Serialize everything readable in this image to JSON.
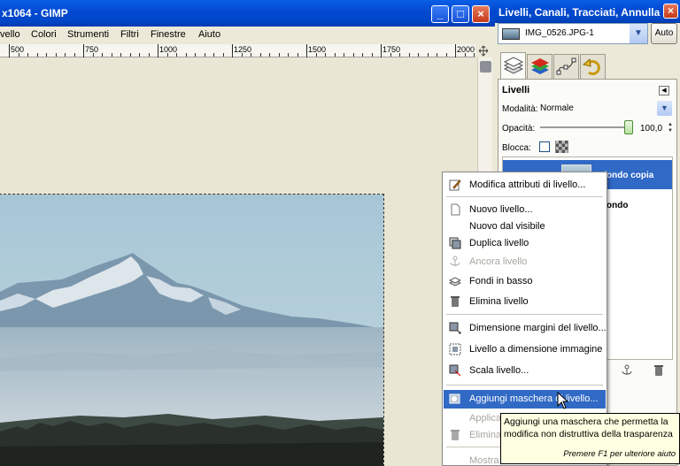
{
  "image_window": {
    "title": "x1064 - GIMP",
    "menu": [
      "vello",
      "Colori",
      "Strumenti",
      "Filtri",
      "Finestre",
      "Aiuto"
    ],
    "ruler_labels": [
      "500",
      "750",
      "1000",
      "1250",
      "1500",
      "1750",
      "2000"
    ]
  },
  "dock": {
    "title": "Livelli, Canali, Tracciati, Annulla ...",
    "image_selector": "IMG_0526.JPG-1",
    "auto_button": "Auto",
    "panel_title": "Livelli",
    "mode_label": "Modalità:",
    "mode_value": "Normale",
    "opacity_label": "Opacità:",
    "opacity_value": "100,0",
    "opacity_fraction": 1.0,
    "lock_label": "Blocca:",
    "layers": [
      {
        "name": "Sfondo copia",
        "selected": true
      },
      {
        "name": "Sfondo",
        "selected": false
      }
    ]
  },
  "context_menu": {
    "items": [
      {
        "label": "Modifica attributi di livello...",
        "enabled": true,
        "icon": "edit-icon"
      },
      {
        "label": "Nuovo livello...",
        "enabled": true,
        "icon": "new-layer-icon"
      },
      {
        "label": "Nuovo dal visibile",
        "enabled": true,
        "icon": ""
      },
      {
        "label": "Duplica livello",
        "enabled": true,
        "icon": "duplicate-icon"
      },
      {
        "label": "Ancora livello",
        "enabled": false,
        "icon": "anchor-icon"
      },
      {
        "label": "Fondi in basso",
        "enabled": true,
        "icon": "merge-down-icon"
      },
      {
        "label": "Elimina livello",
        "enabled": true,
        "icon": "trash-icon"
      },
      {
        "label": "Dimensione margini del livello...",
        "enabled": true,
        "icon": "layer-boundary-icon"
      },
      {
        "label": "Livello a dimensione immagine",
        "enabled": true,
        "icon": "layer-to-image-icon"
      },
      {
        "label": "Scala livello...",
        "enabled": true,
        "icon": "scale-layer-icon"
      },
      {
        "label": "Aggiungi maschera di livello...",
        "enabled": true,
        "highlighted": true,
        "icon": "add-mask-icon"
      },
      {
        "label": "Applica",
        "enabled": false,
        "icon": ""
      },
      {
        "label": "Elimina",
        "enabled": false,
        "icon": "trash-icon"
      },
      {
        "label": "Mostra maschera di livello",
        "enabled": false,
        "icon": ""
      }
    ]
  },
  "tooltip": {
    "line1": "Aggiungi una maschera che permetta la",
    "line2": "modifica non distruttiva della trasparenza",
    "hint": "Premere F1 per ulteriore aiuto"
  },
  "colors": {
    "titlebar": "#0a5ee6",
    "highlight": "#316ac5",
    "tooltip_bg": "#ffffe1"
  }
}
